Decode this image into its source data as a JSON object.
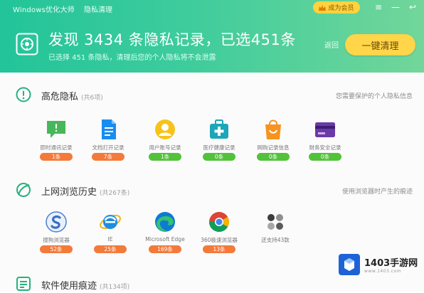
{
  "app": {
    "title": "Windows优化大师",
    "subtitle": "隐私清理",
    "vip_label": "成为会员"
  },
  "summary": {
    "headline": "发现 3434 条隐私记录，已选451条",
    "subline": "已选择 451 条隐私，清理后您的个人隐私将不会泄露",
    "undo_label": "返回",
    "clean_button": "一键清理"
  },
  "sections": [
    {
      "title": "高危隐私",
      "count": "(共6项)",
      "right_note": "您需要保护的个人隐私信息",
      "items": [
        {
          "label": "即时通讯记录",
          "badge": "1条",
          "badge_color": "orange",
          "icon": "chat-icon"
        },
        {
          "label": "文档打开记录",
          "badge": "7条",
          "badge_color": "orange",
          "icon": "document-icon"
        },
        {
          "label": "用户账号记录",
          "badge": "1条",
          "badge_color": "green",
          "icon": "user-icon"
        },
        {
          "label": "医疗健康记录",
          "badge": "0条",
          "badge_color": "green",
          "icon": "medical-kit-icon"
        },
        {
          "label": "网购记录信息",
          "badge": "0条",
          "badge_color": "green",
          "icon": "shopping-bag-icon"
        },
        {
          "label": "财务安全记录",
          "badge": "0条",
          "badge_color": "green",
          "icon": "credit-card-icon"
        }
      ]
    },
    {
      "title": "上网浏览历史",
      "count": "(共267条)",
      "right_note": "使用浏览器时产生的痕迹",
      "items": [
        {
          "label": "搜狗浏览器",
          "badge": "52条",
          "badge_color": "orange",
          "icon": "sogou-browser-icon"
        },
        {
          "label": "IE",
          "badge": "25条",
          "badge_color": "orange",
          "icon": "ie-browser-icon"
        },
        {
          "label": "Microsoft Edge",
          "badge": "169条",
          "badge_color": "orange",
          "icon": "edge-browser-icon"
        },
        {
          "label": "360极速浏览器",
          "badge": "13条",
          "badge_color": "orange",
          "icon": "chrome-browser-icon"
        },
        {
          "label": "还支持43款",
          "badge": "",
          "badge_color": "",
          "icon": "more-apps-icon"
        }
      ]
    },
    {
      "title": "软件使用痕迹",
      "count": "(共134项)",
      "right_note": "",
      "items": []
    }
  ],
  "watermark": {
    "text": "1403手游网",
    "sub": "www.1403.com"
  }
}
